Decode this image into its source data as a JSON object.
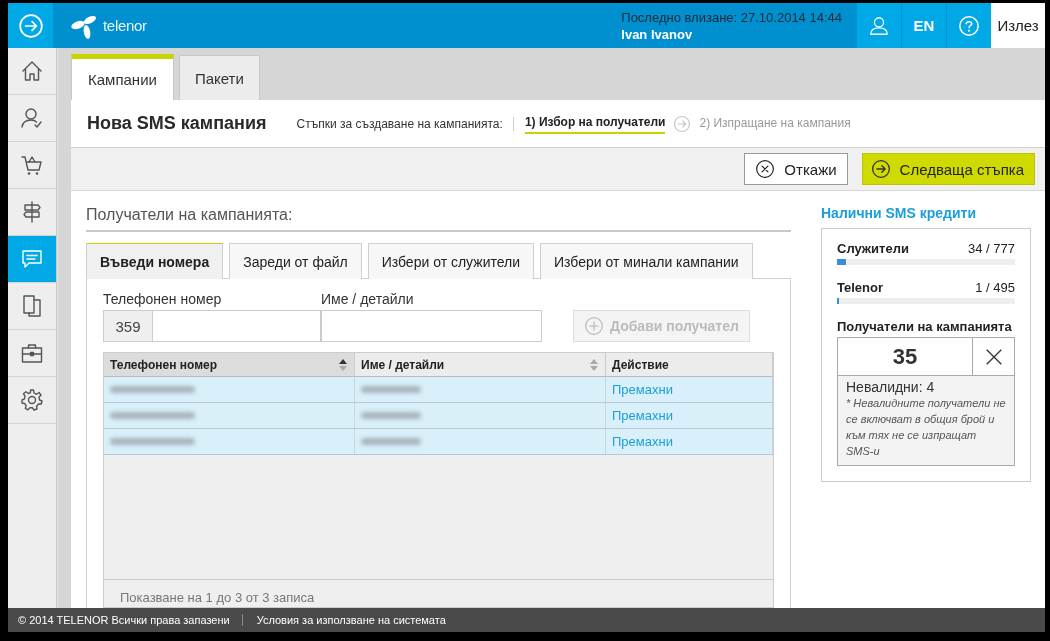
{
  "header": {
    "logo_text": "telenor",
    "last_login": "Последно влизане: 27.10.2014 14:44",
    "user_name": "Ivan Ivanov",
    "language": "EN",
    "logout": "Излез"
  },
  "sidebar": {
    "items": [
      {
        "kind": "home",
        "selected": false
      },
      {
        "kind": "user",
        "selected": false
      },
      {
        "kind": "cart",
        "selected": false
      },
      {
        "kind": "signpost",
        "selected": false
      },
      {
        "kind": "chat",
        "selected": true
      },
      {
        "kind": "documents",
        "selected": false
      },
      {
        "kind": "briefcase",
        "selected": false
      },
      {
        "kind": "settings",
        "selected": false
      }
    ]
  },
  "tabs": [
    {
      "label": "Кампании",
      "selected": true
    },
    {
      "label": "Пакети",
      "selected": false
    }
  ],
  "page_title": "Нова SMS кампания",
  "steps": {
    "label": "Стъпки за създаване на кампанията:",
    "items": [
      {
        "label": "1) Избор на получатели",
        "selected": true
      },
      {
        "label": "2) Изпращане на кампания",
        "selected": false
      }
    ]
  },
  "actions": {
    "cancel": "Откажи",
    "next": "Следваща стъпка"
  },
  "recipients": {
    "title": "Получатели на кампанията:",
    "tabs": [
      {
        "label": "Въведи номера",
        "selected": true
      },
      {
        "label": "Зареди от файл",
        "selected": false
      },
      {
        "label": "Избери от служители",
        "selected": false
      },
      {
        "label": "Избери от минали кампании",
        "selected": false
      }
    ],
    "phone_label": "Телефонен номер",
    "prefix": "359",
    "name_label": "Име / детайли",
    "add_button": {
      "label": "Добави получател",
      "disabled": true
    },
    "table": {
      "columns": [
        {
          "label": "Телефонен номер",
          "sortable": true,
          "sorted": true
        },
        {
          "label": "Име / детайли",
          "sortable": true,
          "sorted": false
        },
        {
          "label": "Действие",
          "sortable": false,
          "sorted": false
        }
      ],
      "rows": [
        {
          "selected": true,
          "action": "Премахни"
        },
        {
          "selected": true,
          "action": "Премахни"
        },
        {
          "selected": true,
          "action": "Премахни"
        }
      ]
    },
    "info": "Показване на 1 до 3 от 3 записа"
  },
  "credits": {
    "title": "Налични SMS кредити",
    "meters": [
      {
        "label": "Служители",
        "reading": "34 / 777",
        "level": 0.05
      },
      {
        "label": "Telenor",
        "reading": "1 / 495",
        "level": 0.01
      }
    ],
    "recipients_label": "Получатели на кампанията",
    "count": "35",
    "invalid": "Невалидни: 4",
    "note": "* Невалидните получатели не се включват в общия брой и към тях не се изпращат SMS-и"
  },
  "footer": {
    "copyright": "© 2014 TELENOR Всички права запазени",
    "terms": "Условия за използване на системата"
  }
}
